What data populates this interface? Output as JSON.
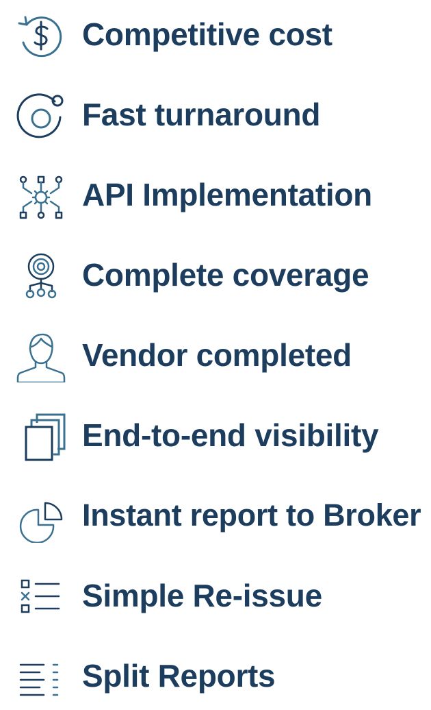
{
  "colors": {
    "text": "#1c3d5e",
    "icon_dark": "#1c3d5e",
    "icon_accent": "#3a7191",
    "background": "#ffffff"
  },
  "features": [
    {
      "label": "Competitive cost",
      "icon": "dollar-cycle-icon"
    },
    {
      "label": "Fast turnaround",
      "icon": "fast-turnaround-icon"
    },
    {
      "label": "API Implementation",
      "icon": "api-network-icon"
    },
    {
      "label": "Complete coverage",
      "icon": "coverage-target-icon"
    },
    {
      "label": "Vendor completed",
      "icon": "person-icon"
    },
    {
      "label": "End-to-end visibility",
      "icon": "stacked-pages-icon"
    },
    {
      "label": "Instant report to Broker",
      "icon": "pie-chart-icon"
    },
    {
      "label": "Simple Re-issue",
      "icon": "checklist-icon"
    },
    {
      "label": "Split Reports",
      "icon": "split-lines-icon"
    }
  ]
}
